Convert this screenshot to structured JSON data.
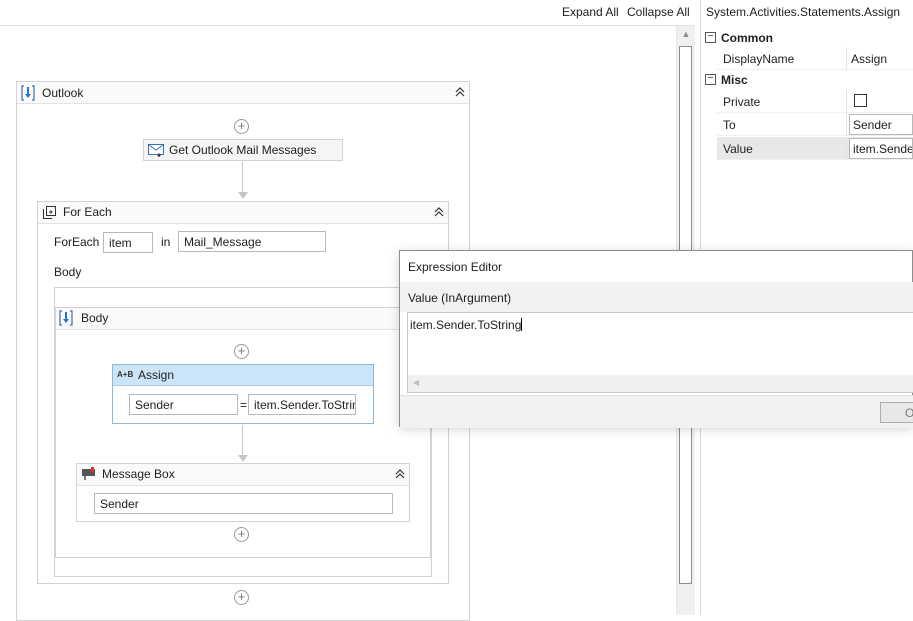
{
  "toolbar": {
    "expand_all": "Expand All",
    "collapse_all": "Collapse All"
  },
  "outlook": {
    "title": "Outlook",
    "get_mail": {
      "title": "Get Outlook Mail Messages"
    },
    "for_each": {
      "title": "For Each",
      "foreach_label": "ForEach",
      "item_var": "item",
      "in_label": "in",
      "collection": "Mail_Message",
      "body_label": "Body",
      "body_sequence": {
        "title": "Body",
        "assign": {
          "title": "Assign",
          "to": "Sender",
          "equals": "=",
          "value": "item.Sender.ToString"
        },
        "message_box": {
          "title": "Message Box",
          "text": "Sender"
        }
      }
    }
  },
  "properties": {
    "title": "System.Activities.Statements.Assign",
    "categories": [
      {
        "name": "Common",
        "toggle": "−",
        "props": [
          {
            "name": "DisplayName",
            "value": "Assign"
          }
        ]
      },
      {
        "name": "Misc",
        "toggle": "−",
        "props": [
          {
            "name": "Private",
            "value": ""
          },
          {
            "name": "To",
            "value": "Sender"
          },
          {
            "name": "Value",
            "value": "item.Sender.ToString"
          }
        ]
      }
    ]
  },
  "expression_editor": {
    "title": "Expression Editor",
    "argument": "Value (InArgument)",
    "text": "item.Sender.ToString",
    "ok_label": "OK"
  },
  "colors": {
    "selected_header": "#cce4f7",
    "selected_border": "#8fb8e0",
    "selected_row": "#e8e8e8"
  }
}
